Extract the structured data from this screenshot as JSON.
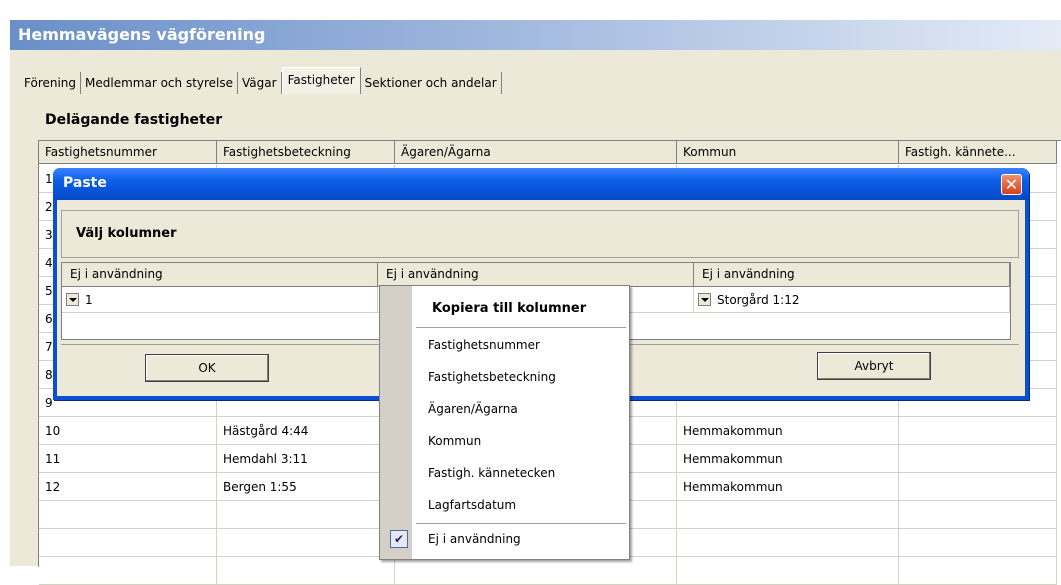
{
  "app": {
    "title": "Hemmavägens vägförening"
  },
  "tabs": [
    "Förening",
    "Medlemmar och styrelse",
    "Vägar",
    "Fastigheter",
    "Sektioner och andelar"
  ],
  "active_tab": "Fastigheter",
  "section": {
    "heading": "Delägande fastigheter"
  },
  "grid": {
    "columns": [
      "Fastighetsnummer",
      "Fastighetsbeteckning",
      "Ägaren/Ägarna",
      "Kommun",
      "Fastigh. kännete..."
    ],
    "rows": [
      [
        "1",
        "",
        "",
        "",
        ""
      ],
      [
        "2",
        "",
        "",
        "",
        ""
      ],
      [
        "3",
        "",
        "",
        "",
        ""
      ],
      [
        "4",
        "",
        "",
        "",
        ""
      ],
      [
        "5",
        "",
        "",
        "",
        ""
      ],
      [
        "6",
        "",
        "",
        "",
        ""
      ],
      [
        "7",
        "",
        "",
        "",
        ""
      ],
      [
        "8",
        "",
        "",
        "",
        ""
      ],
      [
        "9",
        "",
        "",
        "",
        ""
      ],
      [
        "10",
        "Hästgård 4:44",
        "",
        "Hemmakommun",
        ""
      ],
      [
        "11",
        "Hemdahl 3:11",
        "",
        "Hemmakommun",
        ""
      ],
      [
        "12",
        "Bergen 1:55",
        "",
        "Hemmakommun",
        ""
      ],
      [
        "",
        "",
        "",
        "",
        ""
      ],
      [
        "",
        "",
        "",
        "",
        ""
      ],
      [
        "",
        "",
        "",
        "",
        ""
      ]
    ]
  },
  "dialog": {
    "title": "Paste",
    "close_glyph": "✕",
    "choose_label": "Välj kolumner",
    "columns": [
      "Ej i användning",
      "Ej i användning",
      "Ej i användning"
    ],
    "row": [
      "1",
      "",
      "Storgård 1:12"
    ],
    "ok_label": "OK",
    "cancel_label": "Avbryt"
  },
  "menu": {
    "header": "Kopiera till kolumner",
    "items": [
      "Fastighetsnummer",
      "Fastighetsbeteckning",
      "Ägaren/Ägarna",
      "Kommun",
      "Fastigh. kännetecken",
      "Lagfartsdatum"
    ],
    "checked_item": "Ej i användning",
    "check_glyph": "✔"
  }
}
